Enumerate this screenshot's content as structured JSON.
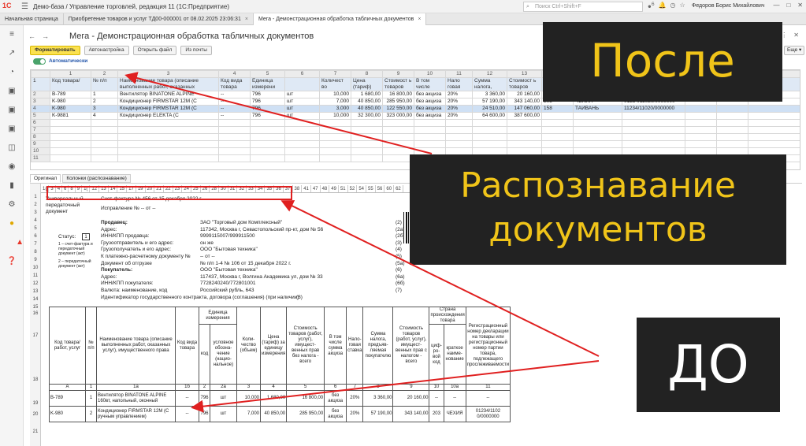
{
  "titlebar": {
    "logo": "1С",
    "title": "Демо-база / Управление торговлей, редакция 11  (1С:Предприятие)",
    "search_placeholder": "Поиск Ctrl+Shift+F",
    "notification_count": "6",
    "user": "Федоров Борис Михайлович"
  },
  "tabs": [
    {
      "label": "Начальная страница"
    },
    {
      "label": "Приобретение товаров и услуг ТД00-000001 от 08.02.2025 23:06:31"
    },
    {
      "label": "Мега - Демонстрационная обработка табличных документов"
    }
  ],
  "window": {
    "title": "Мега - Демонстрационная обработка табличных документов"
  },
  "toolbar": {
    "format": "Форматировать",
    "autosetup": "Автонастройка",
    "open_file": "Открыть файл",
    "from_mail": "Из почты",
    "more": "Еще",
    "auto_label": "Автоматически"
  },
  "grid": {
    "col_numbers": [
      "",
      "1",
      "2",
      "3",
      "4",
      "5",
      "6",
      "7",
      "8",
      "9",
      "10",
      "11",
      "12",
      "13",
      "14",
      "15",
      "16",
      "17",
      "18",
      "19"
    ],
    "headers": [
      "Код товара/",
      "№ п/п",
      "Наименование товара (описание выполненных работ, оказанных",
      "Код вида товара",
      "Единица измерени",
      "",
      "Количест во",
      "Цена (тариф)",
      "Стоимост ь товаров",
      "В том числе",
      "Нало говая",
      "Сумма налога,",
      "Стоимост ь товаров",
      "Код происхо",
      "",
      "",
      "",
      "",
      ""
    ],
    "rows": [
      {
        "n": "2",
        "c": [
          "B-789",
          "1",
          "Вентилятор BINATONE ALPINE",
          "--",
          "796",
          "шт",
          "10,000",
          "1 680,00",
          "16 800,00",
          "без акциза",
          "20%",
          "3 360,00",
          "20 160,00",
          "",
          "",
          "",
          "",
          "",
          ""
        ]
      },
      {
        "n": "3",
        "c": [
          "K-980",
          "2",
          "Кондиционер FIRMSTAR 12M (С",
          "--",
          "796",
          "шт",
          "7,000",
          "40 850,00",
          "285 950,00",
          "без акциза",
          "20%",
          "57 190,00",
          "343 140,00",
          "203",
          "ЧЕХИЯ",
          "01234/11020/0000000",
          "",
          "",
          ""
        ]
      },
      {
        "n": "4",
        "c": [
          "K-980",
          "3",
          "Кондиционер FIRMSTAR 12M (С",
          "--",
          "796",
          "шт",
          "3,000",
          "40 850,00",
          "122 550,00",
          "без акциза",
          "20%",
          "24 510,00",
          "147 060,00",
          "158",
          "ТАЙВАНЬ",
          "11234/11020/0000000",
          "",
          "",
          ""
        ]
      },
      {
        "n": "5",
        "c": [
          "K-9881",
          "4",
          "Кондиционер ELEKTA (С",
          "--",
          "796",
          "шт",
          "10,000",
          "32 300,00",
          "323 000,00",
          "без акциза",
          "20%",
          "64 600,00",
          "387 600,00",
          "",
          "",
          "",
          "",
          "",
          ""
        ]
      },
      {
        "n": "6",
        "c": [
          "",
          "",
          "",
          "",
          "",
          "",
          "",
          "",
          "",
          "",
          "",
          "",
          "",
          "",
          "",
          "",
          "",
          "",
          ""
        ]
      },
      {
        "n": "7",
        "c": [
          "",
          "",
          "",
          "",
          "",
          "",
          "",
          "",
          "",
          "",
          "",
          "",
          "",
          "",
          "",
          "",
          "",
          "",
          ""
        ]
      },
      {
        "n": "8",
        "c": [
          "",
          "",
          "",
          "",
          "",
          "",
          "",
          "",
          "",
          "",
          "",
          "",
          "",
          "",
          "",
          "",
          "",
          "",
          ""
        ]
      },
      {
        "n": "9",
        "c": [
          "",
          "",
          "",
          "",
          "",
          "",
          "",
          "",
          "",
          "",
          "",
          "",
          "",
          "",
          "",
          "",
          "",
          "",
          ""
        ]
      },
      {
        "n": "10",
        "c": [
          "",
          "",
          "",
          "",
          "",
          "",
          "",
          "",
          "",
          "",
          "",
          "",
          "",
          "",
          "",
          "",
          "",
          "",
          ""
        ]
      },
      {
        "n": "11",
        "c": [
          "",
          "",
          "",
          "",
          "",
          "",
          "",
          "",
          "",
          "",
          "",
          "",
          "",
          "",
          "",
          "",
          "",
          "",
          ""
        ]
      }
    ]
  },
  "subtabs": [
    "Оригинал",
    "Колонки (распознавание)"
  ],
  "doc": {
    "colhdr": [
      "1(",
      "3",
      "4",
      "6",
      "8",
      "9",
      "1(",
      "12",
      "13",
      "14",
      "15",
      "17",
      "19",
      "20",
      "21",
      "22",
      "23",
      "24",
      "25",
      "26",
      "28",
      "30",
      "31",
      "32",
      "33",
      "34",
      "35",
      "36",
      "37",
      "38",
      "41",
      "47",
      "48",
      "49",
      "51",
      "52",
      "54",
      "55",
      "56",
      "60",
      "62"
    ],
    "upd_label": "Универсальный передаточный документ",
    "invoice_line": "Счет-фактура № 456     от 15 декабря 2022 г.",
    "correction_line": "Исправление №  --           от  --",
    "status_label": "Статус:",
    "status_value": "1",
    "status_note_1": "1 – счет-фактура и передаточный документ (акт)",
    "status_note_2": "2 – передаточный документ (акт)",
    "fields": [
      {
        "label": "Продавец:",
        "value": "ЗАО \"Торговый дом Комплексный\"",
        "code": "(2)",
        "bold": true
      },
      {
        "label": "Адрес:",
        "value": "117342, Москва г, Севастопольский пр-кт, дом № 56",
        "code": "(2а)"
      },
      {
        "label": "ИНН/КПП продавца:",
        "value": "9999115007/999911500",
        "code": "(2б)"
      },
      {
        "label": "Грузоотправитель и его адрес:",
        "value": "он же",
        "code": "(3)"
      },
      {
        "label": "Грузополучатель и его адрес:",
        "value": "ООО \"Бытовая техника\"",
        "code": "(4)"
      },
      {
        "label": "К платежно-расчетному документу №",
        "value": "-- от --",
        "code": "(5)"
      },
      {
        "label": "Документ об отгрузке",
        "value": "№ п/п 1-4 № 106 от 15 декабря 2022 г.",
        "code": "(5а)"
      },
      {
        "label": "Покупатель:",
        "value": "ООО \"Бытовая техника\"",
        "code": "(6)",
        "bold": true
      },
      {
        "label": "Адрес:",
        "value": "117437, Москва г, Волгина Академика ул, дом № 33",
        "code": "(6а)"
      },
      {
        "label": "ИНН/КПП покупателя:",
        "value": "7728240240/772801001",
        "code": "(6б)"
      },
      {
        "label": "Валюта: наименование, код",
        "value": "Российский рубль, 643",
        "code": "(7)"
      },
      {
        "label": "Идентификатор государственного контракта, договора (соглашения) (при наличии)",
        "value": "",
        "code": "(8)"
      }
    ],
    "row_numbers": [
      "1",
      "2",
      "3",
      "4",
      "5",
      "6",
      "7",
      "8",
      "9",
      "10",
      "11",
      "12",
      "13",
      "14",
      "15",
      "16",
      "17",
      "18",
      "19",
      "20",
      "21"
    ],
    "inv_headers": [
      "Код товара/ работ, услуг",
      "№ п/п",
      "Наименование товара (описание выполненных работ, оказанных услуг), имущественного права",
      "Код вида товара",
      "Единица измерения",
      "Коли-чество (объем)",
      "Цена (тариф) за единицу измерения",
      "Стоимость товаров (работ, услуг), имущест-венных прав без налога - всего",
      "В том числе сумма акциза",
      "Нало-говая ставка",
      "Сумма налога, предъяв-ляемая покупателю",
      "Стоимость товаров (работ, услуг), имущест-венных прав с налогом - всего",
      "Страна происхождения товара",
      "Регистрационный номер декларации на товары или регистрационный номер партии товара, подлежащего прослеживаемости"
    ],
    "unit_sub": [
      "код",
      "условное обозна-чение (нацио-нальное)"
    ],
    "country_sub": [
      "циф-ро-вой код",
      "краткое наиме-нование"
    ],
    "col_letters": [
      "А",
      "1",
      "1а",
      "1б",
      "2",
      "2а",
      "3",
      "4",
      "5",
      "6",
      "7",
      "8",
      "9",
      "10",
      "10а",
      "11"
    ],
    "inv_rows": [
      {
        "code": "B-789",
        "n": "1",
        "name": "Вентилятор BINATONE ALPINE 160вт, напольный, оконный",
        "kind": "--",
        "ucode": "796",
        "uname": "шт",
        "qty": "10,000",
        "price": "1 680,00",
        "cost": "16 800,00",
        "excise": "без акциза",
        "rate": "20%",
        "tax": "3 360,00",
        "total": "20 160,00",
        "ccode": "--",
        "cname": "--",
        "reg": "--"
      },
      {
        "code": "K-980",
        "n": "2",
        "name": "Кондиционер FIRMSTAR 12M (С ручным управлением)",
        "kind": "--",
        "ucode": "796",
        "uname": "шт",
        "qty": "7,000",
        "price": "40 850,00",
        "cost": "285 950,00",
        "excise": "без акциза",
        "rate": "20%",
        "tax": "57 190,00",
        "total": "343 140,00",
        "ccode": "203",
        "cname": "ЧЕХИЯ",
        "reg": "01234/1102 0/0000000"
      }
    ]
  },
  "overlays": {
    "after": "После",
    "recognition": "Распознавание документов",
    "before": "ДО"
  },
  "colors": {
    "accent": "#fbe14f",
    "overlay_bg": "#222222",
    "overlay_text": "#f0c419",
    "arrow": "#e02020",
    "selected_row": "#cfe0f4"
  }
}
